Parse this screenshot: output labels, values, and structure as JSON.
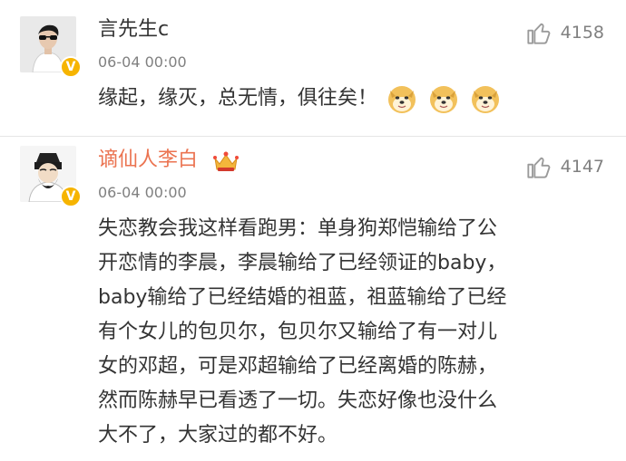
{
  "comments": [
    {
      "user": "言先生c",
      "time": "06-04 00:00",
      "likes": "4158",
      "text": "缘起，缘灭，总无情，俱往矣！",
      "emojis": [
        "doge-emoji",
        "doge-emoji",
        "doge-emoji"
      ]
    },
    {
      "user": "谪仙人李白",
      "time": "06-04 00:00",
      "likes": "4147",
      "lines": [
        "失恋教会我这样看跑男：单身狗郑恺输给了公",
        "开恋情的李晨，李晨输给了已经领证的baby，",
        "baby输给了已经结婚的祖蓝，祖蓝输给了已经",
        "有个女儿的包贝尔，包贝尔又输给了有一对儿",
        "女的邓超，可是邓超输给了已经离婚的陈赫，",
        "然而陈赫早已看透了一切。失恋好像也没什么",
        "大不了，大家过的都不好。"
      ]
    }
  ],
  "colors": {
    "name_highlight": "#eb7350",
    "verified": "#f6b400",
    "meta": "#808080"
  }
}
